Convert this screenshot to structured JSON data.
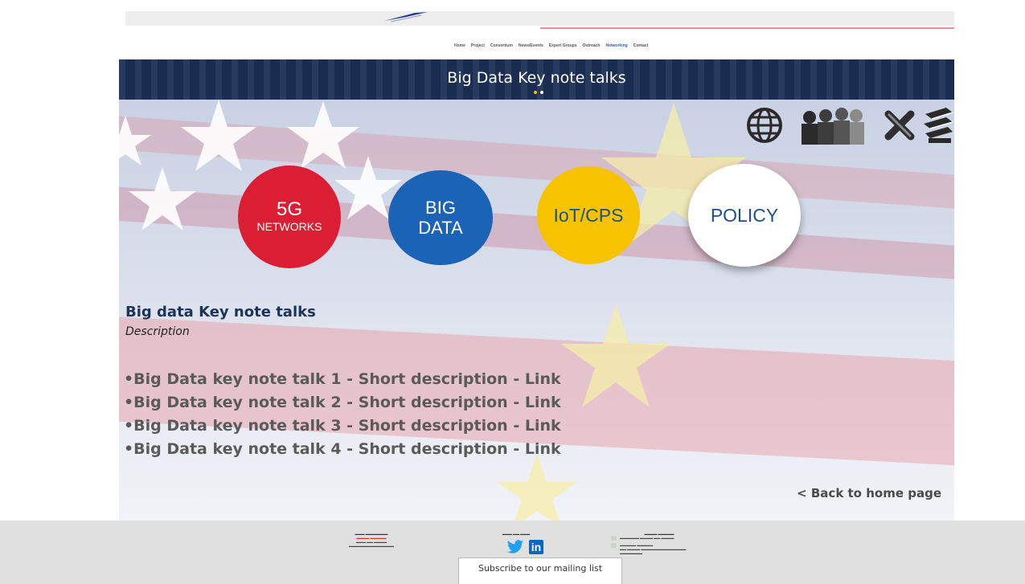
{
  "nav": {
    "items": [
      "Home",
      "Project",
      "Consortium",
      "News/Events",
      "Expert Groups",
      "Outreach",
      "Networking",
      "Contact"
    ],
    "active": "Networking"
  },
  "banner": {
    "title": "Big Data Key note talks"
  },
  "circles": {
    "c5g_big": "5G",
    "c5g_small": "NETWORKS",
    "bigdata_line1": "BIG",
    "bigdata_line2": "DATA",
    "iot": "IoT/CPS",
    "policy": "POLICY"
  },
  "icons": [
    "globe-icon",
    "people-group-icon",
    "tools-icon",
    "books-icon"
  ],
  "content": {
    "heading": "Big data Key note talks",
    "description": "Description",
    "talks": [
      "Big Data key note talk 1 - Short description - Link",
      "Big Data key note talk 2 - Short description - Link",
      "Big Data key note talk 3 - Short description - Link",
      "Big Data key note talk 4 - Short description - Link"
    ],
    "back_link": "< Back to home page"
  },
  "footer": {
    "subscribe": "Subscribe to our mailing list"
  },
  "colors": {
    "banner": "#1c2f55",
    "red": "#dc1e34",
    "blue": "#1b63b7",
    "yellow": "#f7c300",
    "text_dark": "#1e3457"
  }
}
